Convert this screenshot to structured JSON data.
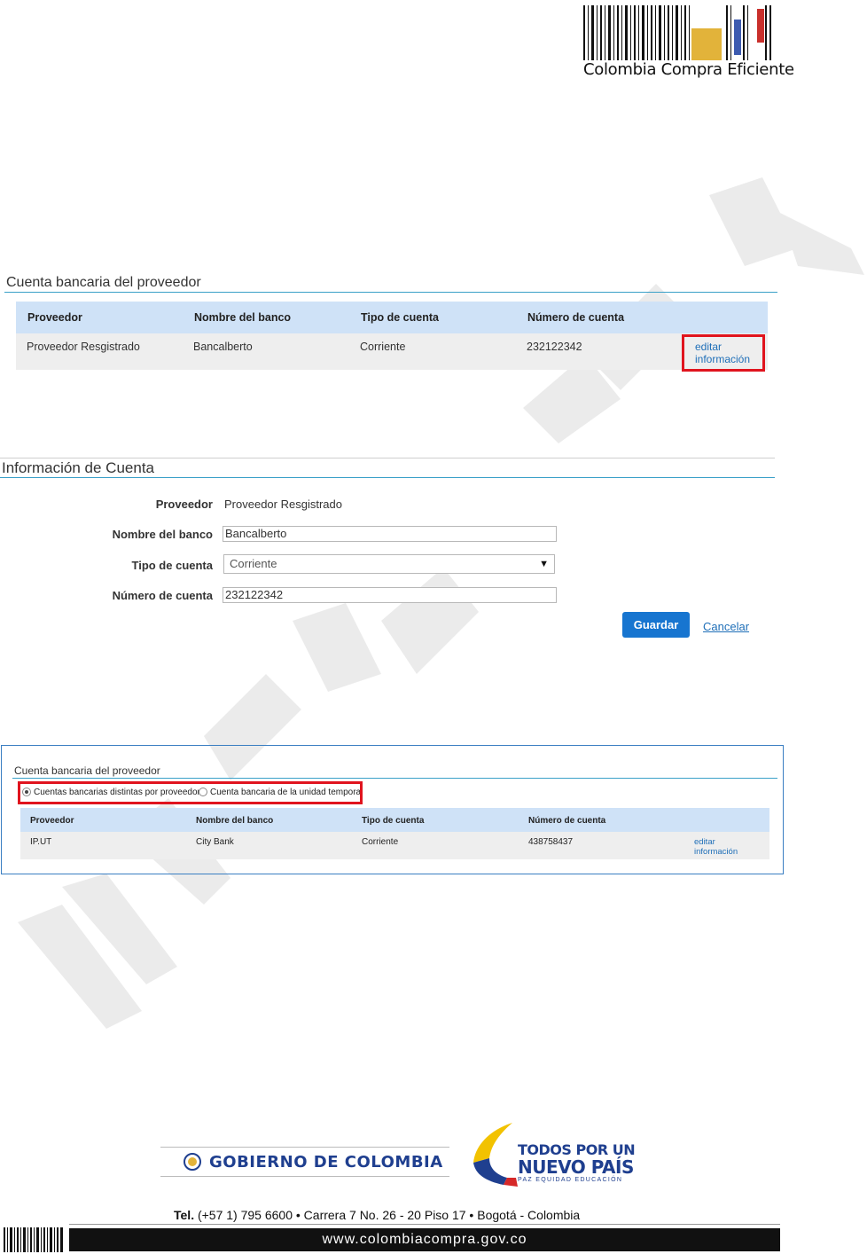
{
  "header": {
    "brand": "Colombia Compra Eficiente"
  },
  "section1": {
    "title": "Cuenta bancaria del proveedor",
    "columns": [
      "Proveedor",
      "Nombre del banco",
      "Tipo de cuenta",
      "Número de cuenta"
    ],
    "row": {
      "proveedor": "Proveedor Resgistrado",
      "banco": "Bancalberto",
      "tipo": "Corriente",
      "numero": "232122342",
      "link_line1": "editar",
      "link_line2": "información"
    }
  },
  "section2": {
    "title": "Información de Cuenta",
    "labels": {
      "proveedor": "Proveedor",
      "banco": "Nombre del banco",
      "tipo": "Tipo de cuenta",
      "numero": "Número de cuenta"
    },
    "values": {
      "proveedor": "Proveedor Resgistrado",
      "banco": "Bancalberto",
      "tipo": "Corriente",
      "numero": "232122342"
    },
    "save_label": "Guardar",
    "cancel_label": "Cancelar"
  },
  "section3": {
    "title": "Cuenta bancaria del proveedor",
    "radio1": "Cuentas bancarias distintas por proveedor",
    "radio2": "Cuenta bancaria de la unidad temporal",
    "columns": [
      "Proveedor",
      "Nombre del banco",
      "Tipo de cuenta",
      "Número de cuenta"
    ],
    "row": {
      "proveedor": "IP.UT",
      "banco": "City Bank",
      "tipo": "Corriente",
      "numero": "438758437",
      "link_line1": "editar",
      "link_line2": "información"
    }
  },
  "footer": {
    "gobierno": "GOBIERNO DE COLOMBIA",
    "todos_line1": "TODOS POR UN",
    "todos_line2": "NUEVO PAÍS",
    "todos_line3": "PAZ   EQUIDAD   EDUCACIÓN",
    "contact_label": "Tel.",
    "contact": " (+57 1) 795 6600 • Carrera 7 No. 26 - 20 Piso 17 • Bogotá - Colombia",
    "website": "www.colombiacompra.gov.co"
  },
  "colors": {
    "accent_blue": "#1775d0",
    "highlight_red": "#e0141e",
    "table_header": "#cfe2f7"
  }
}
